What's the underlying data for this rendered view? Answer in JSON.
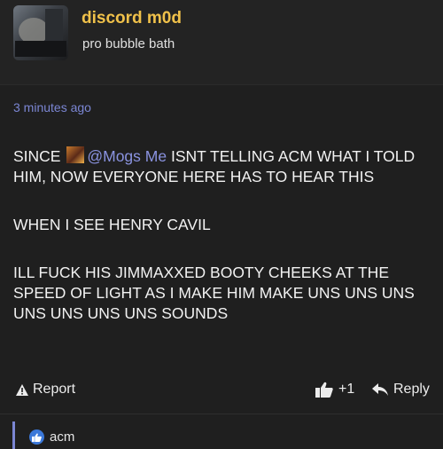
{
  "post": {
    "author": {
      "name": "discord m0d",
      "title": "pro bubble bath"
    },
    "timestamp": "3 minutes ago",
    "message": {
      "line1_pre": "SINCE",
      "mention": "@Mogs Me",
      "line1_post": " ISNT TELLING ACM WHAT I TOLD HIM, NOW EVERYONE HERE HAS TO HEAR THIS",
      "para2": "WHEN I SEE HENRY CAVIL",
      "para3": "ILL FUCK HIS JIMMAXXED BOOTY CHEEKS AT THE SPEED OF LIGHT AS I MAKE HIM MAKE UNS UNS UNS UNS UNS UNS UNS SOUNDS"
    },
    "actions": {
      "report": "Report",
      "like_count": "+1",
      "reply": "Reply"
    },
    "reactions": [
      {
        "icon": "thumbs-up-icon",
        "user": "acm"
      }
    ]
  },
  "colors": {
    "background": "#1f1f1f",
    "username": "#f0c14a",
    "accent": "#7b86d3",
    "reaction_badge": "#3b78d9"
  }
}
